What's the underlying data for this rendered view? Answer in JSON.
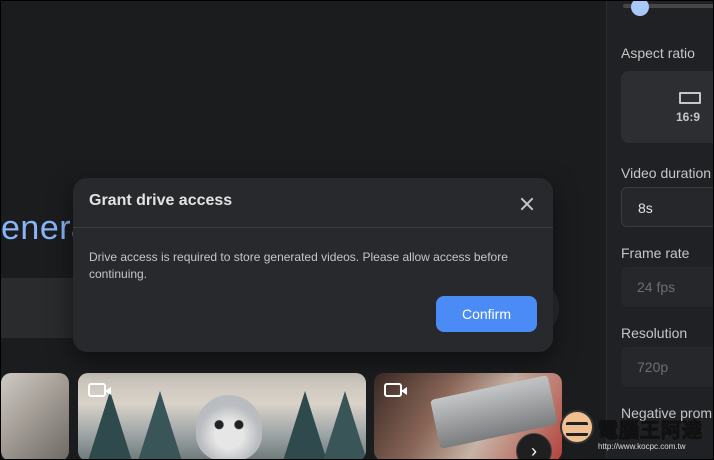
{
  "main": {
    "hero_text": "enera"
  },
  "settings": {
    "aspect_ratio_label": "Aspect ratio",
    "aspect_ratio_value": "16:9",
    "duration_label": "Video duration",
    "duration_value": "8s",
    "frame_rate_label": "Frame rate",
    "frame_rate_value": "24 fps",
    "resolution_label": "Resolution",
    "resolution_value": "720p",
    "negative_prompt_label": "Negative prom"
  },
  "dialog": {
    "title": "Grant drive access",
    "message": "Drive access is required to store generated videos. Please allow access before continuing.",
    "confirm_label": "Confirm"
  },
  "icons": {
    "close": "close-icon",
    "video": "video-icon",
    "next": "chevron-right-icon",
    "aspect": "aspect-ratio-icon"
  },
  "watermark": {
    "text": "電腦王阿達",
    "url": "http://www.kocpc.com.tw"
  },
  "colors": {
    "accent": "#4b8bf5",
    "hero_text": "#8ab4f8",
    "dialog_bg": "#28292c",
    "page_bg": "#1b1c1e"
  }
}
